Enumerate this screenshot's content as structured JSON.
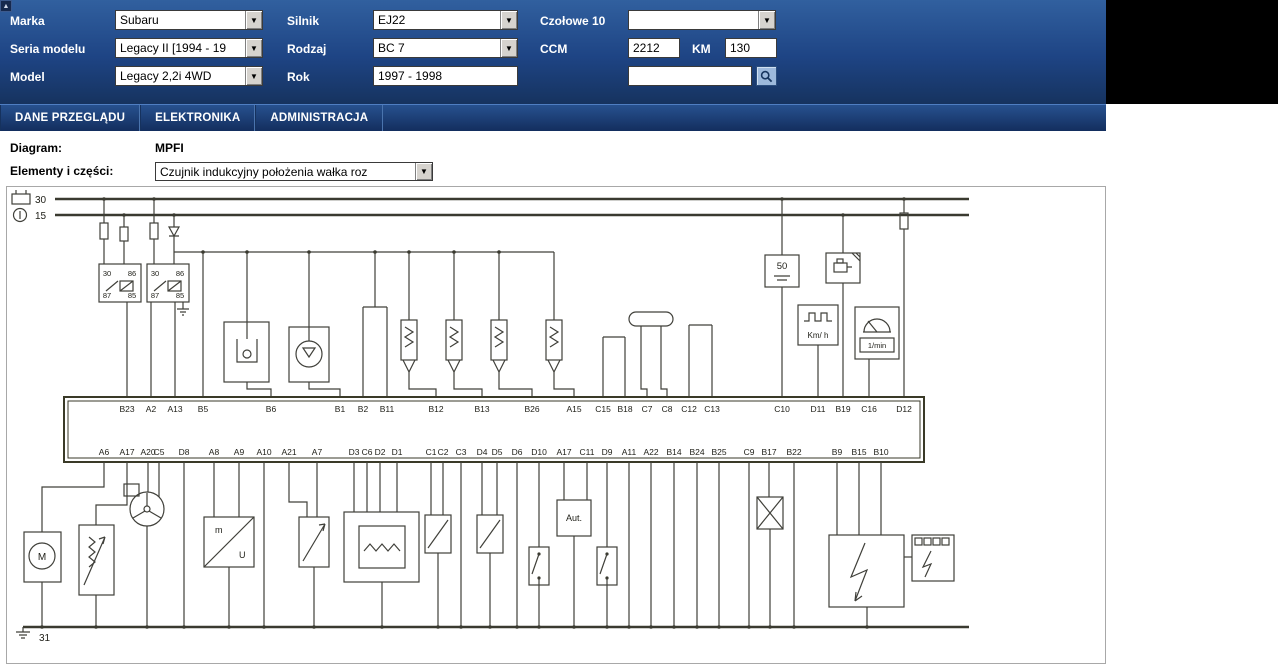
{
  "icons": {
    "dropdown": "▼",
    "corner": "▲"
  },
  "header": {
    "marka": {
      "label": "Marka",
      "value": "Subaru"
    },
    "seria": {
      "label": "Seria modelu",
      "value": "Legacy II [1994 - 19"
    },
    "model": {
      "label": "Model",
      "value": "Legacy 2,2i 4WD"
    },
    "silnik": {
      "label": "Silnik",
      "value": "EJ22"
    },
    "rodzaj": {
      "label": "Rodzaj",
      "value": "BC 7"
    },
    "rok": {
      "label": "Rok",
      "value": "1997 - 1998"
    },
    "czolowe": {
      "label": "Czołowe 10",
      "value": ""
    },
    "ccm": {
      "label": "CCM",
      "value": "2212"
    },
    "km": {
      "label": "KM",
      "value": "130"
    },
    "query": {
      "value": ""
    }
  },
  "menu": {
    "items": [
      "DANE PRZEGLĄDU",
      "ELEKTRONIKA",
      "ADMINISTRACJA"
    ]
  },
  "info": {
    "diagram_label": "Diagram:",
    "diagram_value": "MPFI",
    "elements_label": "Elementy i części:",
    "elements_value": "Czujnik indukcyjny położenia wałka roz"
  },
  "diagram": {
    "bus": {
      "b30": "30",
      "b15": "15",
      "b31": "31"
    },
    "relay": {
      "p30": "30",
      "p86": "86",
      "p87": "87",
      "p85": "85"
    },
    "labels": {
      "starter": "50",
      "speed": "Km/ h",
      "tach": "1/min",
      "aut": "Aut.",
      "motor": "M",
      "m": "m",
      "u": "U"
    },
    "ecu": {
      "top_pins": [
        "B23",
        "A2",
        "A13",
        "B5",
        "B6",
        "B1",
        "B2",
        "B11",
        "B12",
        "B13",
        "B26",
        "A15",
        "C15",
        "B18",
        "C7",
        "C8",
        "C12",
        "C13",
        "C10",
        "D11",
        "B19",
        "C16",
        "D12"
      ],
      "bottom_pins": [
        "A6",
        "A17",
        "A20",
        "C5",
        "D8",
        "A8",
        "A9",
        "A10",
        "A21",
        "A7",
        "D3",
        "C6",
        "D2",
        "D1",
        "C1",
        "C2",
        "C3",
        "D4",
        "D5",
        "D6",
        "D10",
        "A17",
        "C11",
        "D9",
        "A11",
        "A22",
        "B14",
        "B24",
        "B25",
        "C9",
        "B17",
        "B22",
        "B9",
        "B15",
        "B10"
      ]
    }
  }
}
